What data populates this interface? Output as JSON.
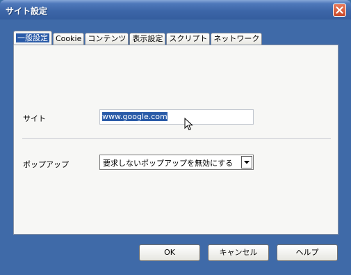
{
  "window": {
    "title": "サイト設定",
    "close_icon": "close-icon"
  },
  "tabs": [
    {
      "label": "一般設定",
      "active": true
    },
    {
      "label": "Cookie"
    },
    {
      "label": "コンテンツ"
    },
    {
      "label": "表示設定"
    },
    {
      "label": "スクリプト"
    },
    {
      "label": "ネットワーク"
    }
  ],
  "general": {
    "site_label": "サイト",
    "site_value": "www.google.com",
    "popup_label": "ポップアップ",
    "popup_selected": "要求しないポップアップを無効にする"
  },
  "buttons": {
    "ok": "OK",
    "cancel": "キャンセル",
    "help": "ヘルプ"
  },
  "colors": {
    "titlebar": "#3d66a8",
    "selection": "#2a5ba8",
    "close_button": "#d2573a"
  }
}
